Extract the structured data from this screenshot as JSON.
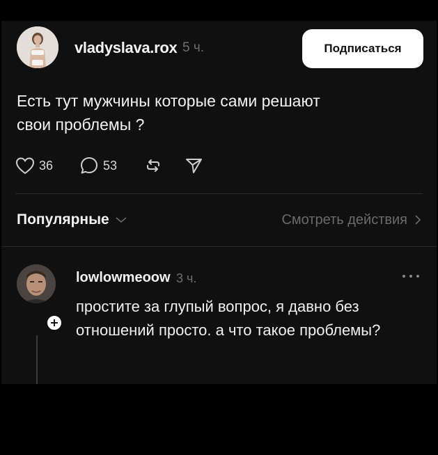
{
  "post": {
    "username": "vladyslava.rox",
    "time": "5 ч.",
    "follow_label": "Подписаться",
    "text": "Есть тут мужчины которые сами решают\nсвои проблемы ?",
    "likes": "36",
    "replies": "53"
  },
  "filters": {
    "sort_label": "Популярные",
    "activity_label": "Смотреть действия"
  },
  "comment": {
    "username": "lowlowmeoow",
    "time": "3 ч.",
    "text": "простите за глупый вопрос, я давно без отношений просто. а что такое проблемы?"
  },
  "colors": {
    "background": "#101010",
    "muted": "#6f6f6f",
    "button_bg": "#ffffff"
  },
  "icons": [
    "heart-icon",
    "comment-icon",
    "repost-icon",
    "share-icon",
    "chevron-down-icon",
    "chevron-right-icon",
    "more-icon",
    "plus-icon"
  ]
}
